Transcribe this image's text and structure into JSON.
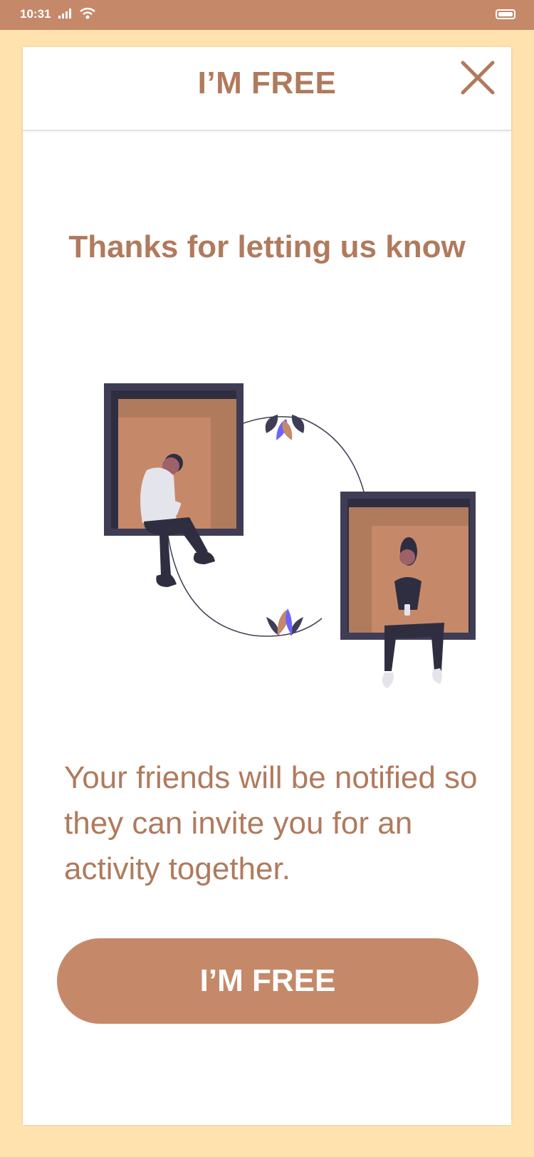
{
  "status_bar": {
    "time": "10:31"
  },
  "header": {
    "title": "I’M FREE",
    "close_icon": "close-icon"
  },
  "main": {
    "heading": "Thanks for letting us know",
    "message": "Your friends will be notified so they can invite you for an activity together.",
    "cta_label": "I’M FREE"
  },
  "colors": {
    "accent": "#C5896A",
    "text": "#B07A5D",
    "page_background": "#FFE2AE",
    "card_background": "#FFFFFF",
    "frame_dark": "#3F3D56",
    "leaf_purple": "#6C63FF"
  }
}
